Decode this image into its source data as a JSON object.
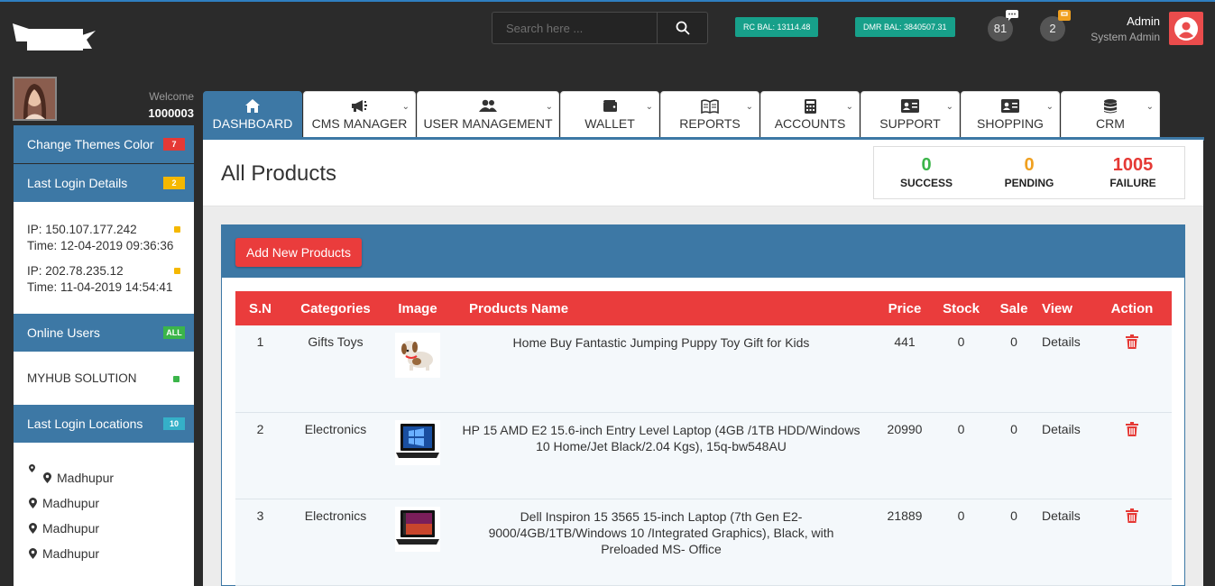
{
  "header": {
    "search_placeholder": "Search here ...",
    "rc_balance": "RC BAL: 13114.48",
    "dmr_balance": "DMR BAL: 3840507.31",
    "messages_count": "81",
    "orders_count": "2",
    "admin_name": "Admin",
    "admin_role": "System Admin"
  },
  "sidebar": {
    "welcome": "Welcome",
    "user_id": "1000003",
    "change_themes": {
      "label": "Change Themes Color",
      "count": "7",
      "color": "#e53935"
    },
    "last_login": {
      "label": "Last Login Details",
      "count": "2",
      "color": "#f5b800"
    },
    "logins": [
      {
        "ip": "IP: 150.107.177.242",
        "time": "Time: 12-04-2019 09:36:36"
      },
      {
        "ip": "IP: 202.78.235.12",
        "time": "Time: 11-04-2019 14:54:41"
      }
    ],
    "online_users": {
      "label": "Online Users",
      "count": "ALL",
      "color": "#3bb54a"
    },
    "online_list": [
      "MYHUB SOLUTION"
    ],
    "last_locations": {
      "label": "Last Login Locations",
      "count": "10",
      "color": "#35b0c8"
    },
    "locations": [
      "Madhupur",
      "Madhupur",
      "Madhupur",
      "Madhupur"
    ]
  },
  "tabs": [
    {
      "label": "DASHBOARD",
      "icon": "home-icon",
      "active": true
    },
    {
      "label": "CMS MANAGER",
      "icon": "megaphone-icon"
    },
    {
      "label": "USER MANAGEMENT",
      "icon": "users-icon"
    },
    {
      "label": "WALLET",
      "icon": "wallet-icon"
    },
    {
      "label": "REPORTS",
      "icon": "book-icon"
    },
    {
      "label": "ACCOUNTS",
      "icon": "calculator-icon"
    },
    {
      "label": "SUPPORT",
      "icon": "id-card-icon"
    },
    {
      "label": "SHOPPING",
      "icon": "id-card-icon"
    },
    {
      "label": "CRM",
      "icon": "database-icon"
    }
  ],
  "page": {
    "title": "All Products",
    "stats": [
      {
        "value": "0",
        "label": "SUCCESS",
        "color": "#3bb54a"
      },
      {
        "value": "0",
        "label": "PENDING",
        "color": "#f0a020"
      },
      {
        "value": "1005",
        "label": "FAILURE",
        "color": "#e53935"
      }
    ],
    "add_button": "Add New Products"
  },
  "table": {
    "headers": [
      "S.N",
      "Categories",
      "Image",
      "Products Name",
      "Price",
      "Stock",
      "Sale",
      "View",
      "Action"
    ],
    "rows": [
      {
        "sn": "1",
        "category": "Gifts Toys",
        "image": "puppy-toy-image",
        "name": "Home Buy Fantastic Jumping Puppy Toy Gift for Kids",
        "price": "441",
        "stock": "0",
        "sale": "0",
        "view": "Details"
      },
      {
        "sn": "2",
        "category": "Electronics",
        "image": "laptop-windows-image",
        "name": "HP 15 AMD E2 15.6-inch Entry Level Laptop (4GB /1TB HDD/Windows 10 Home/Jet Black/2.04 Kgs), 15q-bw548AU",
        "price": "20990",
        "stock": "0",
        "sale": "0",
        "view": "Details"
      },
      {
        "sn": "3",
        "category": "Electronics",
        "image": "laptop-ubuntu-image",
        "name": "Dell Inspiron 15 3565 15-inch Laptop (7th Gen E2-9000/4GB/1TB/Windows 10 /Integrated Graphics), Black, with Preloaded MS- Office",
        "price": "21889",
        "stock": "0",
        "sale": "0",
        "view": "Details"
      }
    ]
  },
  "colors": {
    "accent": "#3d78a5",
    "danger": "#ea3c3c",
    "topbar": "#2b2b2b",
    "balance": "#17a08a"
  }
}
